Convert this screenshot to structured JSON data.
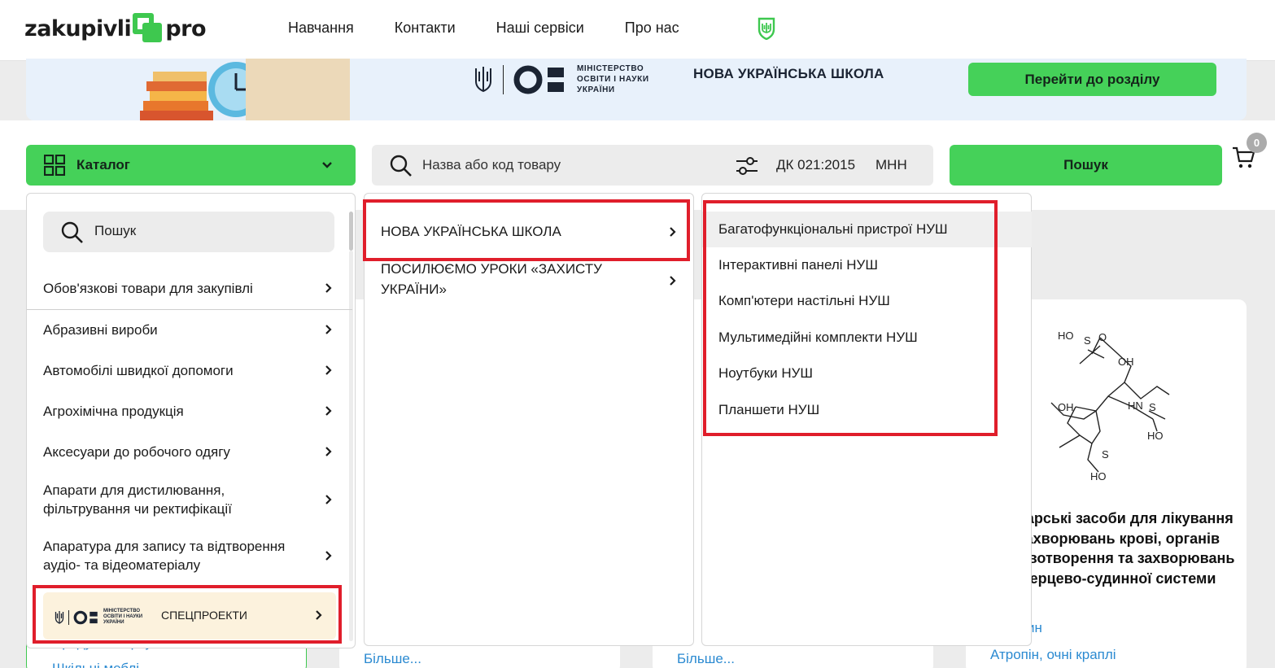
{
  "header": {
    "logo_left": "zakupivli",
    "logo_right": "pro",
    "nav": [
      "Навчання",
      "Контакти",
      "Наші сервіси",
      "Про нас"
    ]
  },
  "banner": {
    "ministry_line1": "МІНІСТЕРСТВО",
    "ministry_line2": "ОСВІТИ І НАУКИ",
    "ministry_line3": "УКРАЇНИ",
    "title": "НОВА УКРАЇНСЬКА ШКОЛА",
    "button": "Перейти до розділу"
  },
  "search": {
    "catalog_label": "Каталог",
    "placeholder": "Назва або код товару",
    "dk_label": "ДК 021:2015",
    "mnn_label": "МНН",
    "button": "Пошук",
    "cart_count": "0"
  },
  "catalog_panel": {
    "search_label": "Пошук",
    "items": [
      "Обов'язкові товари для закупівлі",
      "Абразивні вироби",
      "Автомобілі швидкої допомоги",
      "Агрохімічна продукція",
      "Аксесуари до робочого одягу",
      "Апарати для дистилювання, фільтрування чи ректифікації",
      "Апаратура для запису та відтворення аудіо- та відеоматеріалу"
    ],
    "special": {
      "ministry_line1": "МІНІСТЕРСТВО",
      "ministry_line2": "ОСВІТИ І НАУКИ",
      "ministry_line3": "УКРАЇНИ",
      "label": "СПЕЦПРОЕКТИ"
    }
  },
  "subcategory_panel": {
    "items": [
      "НОВА УКРАЇНСЬКА ШКОЛА",
      "ПОСИЛЮЄМО УРОКИ «ЗАХИСТУ УКРАЇНИ»"
    ]
  },
  "product_panel": {
    "items": [
      "Багатофункціональні пристрої НУШ",
      "Інтерактивні панелі НУШ",
      "Комп'ютери настільні НУШ",
      "Мультимедійні комплекти НУШ",
      "Ноутбуки НУШ",
      "Планшети НУШ"
    ]
  },
  "background": {
    "card_title": "Лікарські засоби для лікування захворювань крові, органів кровотворення та захворювань серцево-судинної системи",
    "link_more_1": "Більше...",
    "link_more_2": "Більше...",
    "link_atropine": "Атропін, очні краплі",
    "link_partial": "ин",
    "link_left_1": "Продукти харчування",
    "link_left_2": "Шкільні меблі",
    "molecule": {
      "ho": "HO",
      "s": "S",
      "o": "O",
      "oh": "OH",
      "hn": "HN"
    }
  },
  "colors": {
    "accent_green": "#45d159",
    "highlight_red": "#e01e2b",
    "banner_bg": "#e8f1fb",
    "special_bg": "#fcf2dd",
    "link_blue": "#2b8ad1"
  }
}
